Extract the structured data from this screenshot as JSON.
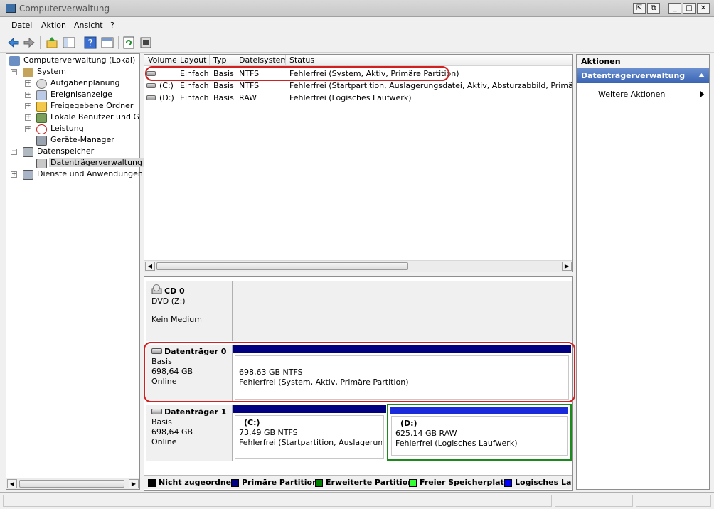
{
  "window": {
    "title": "Computerverwaltung",
    "buttons": [
      "⇱",
      "⧉",
      "_",
      "□",
      "✕"
    ]
  },
  "menu": [
    "Datei",
    "Aktion",
    "Ansicht",
    "?"
  ],
  "toolbar_icons": [
    "back-icon",
    "forward-icon",
    "up-folder-icon",
    "show-hide-tree-icon",
    "help-icon",
    "properties-icon",
    "refresh-icon",
    "settings-icon"
  ],
  "tree": {
    "root": "Computerverwaltung (Lokal)",
    "system": "System",
    "system_children": [
      "Aufgabenplanung",
      "Ereignisanzeige",
      "Freigegebene Ordner",
      "Lokale Benutzer und Gruppen",
      "Leistung",
      "Geräte-Manager"
    ],
    "storage": "Datenspeicher",
    "storage_children": [
      "Datenträgerverwaltung"
    ],
    "services": "Dienste und Anwendungen"
  },
  "volume_table": {
    "columns": [
      "Volume",
      "Layout",
      "Typ",
      "Dateisystem",
      "Status"
    ],
    "rows": [
      {
        "volume": "",
        "layout": "Einfach",
        "type": "Basis",
        "fs": "NTFS",
        "status": "Fehlerfrei (System, Aktiv, Primäre Partition)"
      },
      {
        "volume": "(C:)",
        "layout": "Einfach",
        "type": "Basis",
        "fs": "NTFS",
        "status": "Fehlerfrei (Startpartition, Auslagerungsdatei, Aktiv, Absturzabbild, Primäre Partition)"
      },
      {
        "volume": "(D:)",
        "layout": "Einfach",
        "type": "Basis",
        "fs": "RAW",
        "status": "Fehlerfrei (Logisches Laufwerk)"
      }
    ]
  },
  "disks": {
    "cd0": {
      "title": "CD 0",
      "line1": "DVD (Z:)",
      "line2": "Kein Medium"
    },
    "disk0": {
      "title": "Datenträger 0",
      "type": "Basis",
      "size": "698,64 GB",
      "state": "Online",
      "partition": {
        "size": "698,63 GB NTFS",
        "status": "Fehlerfrei (System, Aktiv, Primäre Partition)"
      }
    },
    "disk1": {
      "title": "Datenträger 1",
      "type": "Basis",
      "size": "698,64 GB",
      "state": "Online",
      "c": {
        "name": "(C:)",
        "size": "73,49 GB NTFS",
        "status": "Fehlerfrei (Startpartition, Auslagerungsdatei)"
      },
      "d": {
        "name": "(D:)",
        "size": "625,14 GB RAW",
        "status": "Fehlerfrei (Logisches Laufwerk)"
      }
    }
  },
  "legend": [
    {
      "label": "Nicht zugeordnet",
      "color": "#000000"
    },
    {
      "label": "Primäre Partition",
      "color": "#000080"
    },
    {
      "label": "Erweiterte Partition",
      "color": "#008000"
    },
    {
      "label": "Freier Speicherplatz",
      "color": "#33ff33"
    },
    {
      "label": "Logisches Laufwerk",
      "color": "#0000ff"
    }
  ],
  "actions": {
    "header": "Aktionen",
    "section": "Datenträgerverwaltung",
    "more": "Weitere Aktionen"
  },
  "colors": {
    "primary": "#000080",
    "logical": "#1a2bdc",
    "extended": "#00801a",
    "highlight": "#d21f1f"
  }
}
